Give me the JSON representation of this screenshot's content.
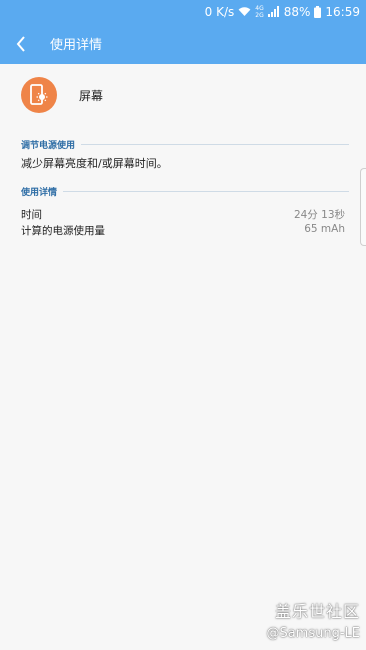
{
  "status_bar": {
    "speed": "0 K/s",
    "net_top": "4G",
    "net_bottom": "2G",
    "battery": "88%",
    "time": "16:59"
  },
  "app_bar": {
    "title": "使用详情"
  },
  "app": {
    "name": "屏幕",
    "icon": "screen-brightness-icon"
  },
  "section_adjust": {
    "header": "调节电源使用",
    "tip": "减少屏幕亮度和/或屏幕时间。"
  },
  "section_details": {
    "header": "使用详情",
    "rows": [
      {
        "label": "时间",
        "value": "24分 13秒"
      },
      {
        "label": "计算的电源使用量",
        "value": "65 mAh"
      }
    ]
  },
  "watermark": {
    "line1": "盖乐世社区",
    "line2": "@Samsung-LE"
  },
  "colors": {
    "app_bar": "#5aaaf0",
    "icon_bg": "#ef8448",
    "section_header": "#2f6ea6"
  }
}
